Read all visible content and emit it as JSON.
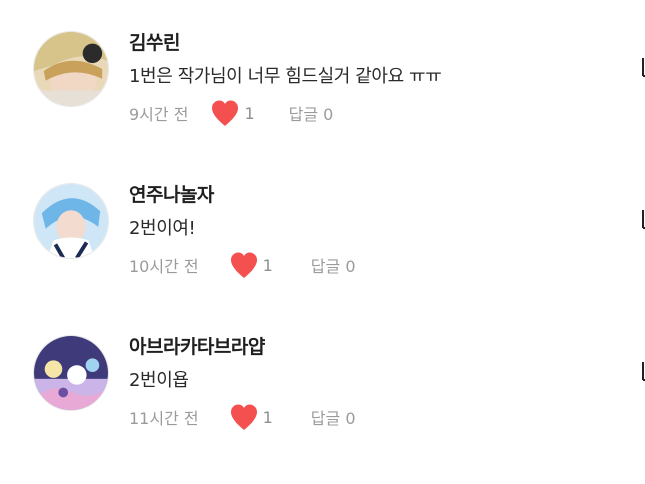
{
  "comments": [
    {
      "username": "김쑤린",
      "text": "1번은 작가님이 너무 힘드실거 같아요 ㅠㅠ",
      "time": "9시간 전",
      "likes": "1",
      "reply": "답글 0"
    },
    {
      "username": "연주나놀자",
      "text": "2번이여!",
      "time": "10시간 전",
      "likes": "1",
      "reply": "답글 0"
    },
    {
      "username": "아브라카타브라얍",
      "text": "2번이욥",
      "time": "11시간 전",
      "likes": "1",
      "reply": "답글 0"
    }
  ],
  "colors": {
    "heart": "#f4504f",
    "meta": "#9b9b9b",
    "username": "#1f1f1f"
  },
  "icons": {
    "like": "heart-icon",
    "more": "more-options-icon"
  }
}
